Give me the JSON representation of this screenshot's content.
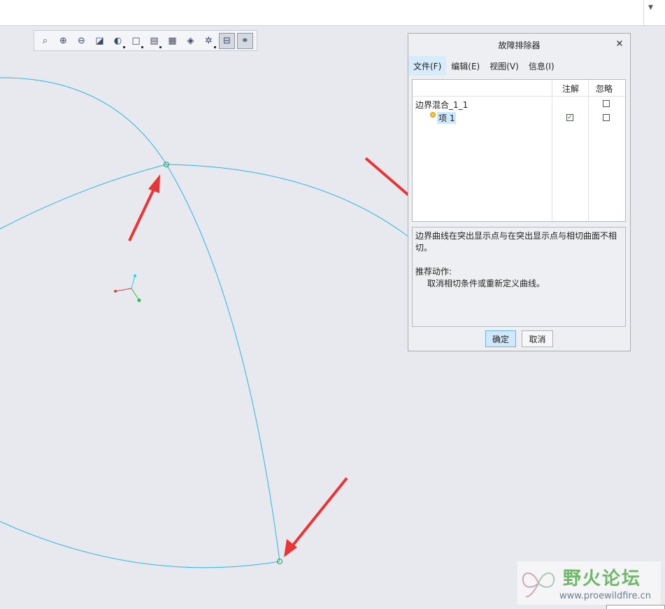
{
  "dialog": {
    "title": "故障排除器",
    "close_label": "×",
    "menu": [
      {
        "label": "文件(F)"
      },
      {
        "label": "编辑(E)"
      },
      {
        "label": "视图(V)"
      },
      {
        "label": "信息(I)"
      }
    ],
    "columns": {
      "annotation": "注解",
      "ignore": "忽略"
    },
    "tree": [
      {
        "label": "边界混合_1_1",
        "annotated": false,
        "ignored": false
      },
      {
        "label": "项 1",
        "annotated": true,
        "ignored": false,
        "selected": true
      }
    ],
    "message": {
      "description": "边界曲线在突出显示点与在突出显示点与相切曲面不相切。",
      "action_title": "推荐动作:",
      "action_text": "取消相切条件或重新定义曲线。"
    },
    "ok_label": "确定",
    "cancel_label": "取消"
  },
  "toolbar": {
    "buttons": [
      {
        "name": "refit-icon",
        "glyph": "⌕"
      },
      {
        "name": "zoom-in-icon",
        "glyph": "⊕"
      },
      {
        "name": "zoom-out-icon",
        "glyph": "⊖"
      },
      {
        "name": "repaint-icon",
        "glyph": "◪"
      },
      {
        "name": "display-style-icon",
        "glyph": "◐"
      },
      {
        "name": "saved-orientation-icon",
        "glyph": "□"
      },
      {
        "name": "view-manager-icon",
        "glyph": "▤"
      },
      {
        "name": "perspective-icon",
        "glyph": "▦"
      },
      {
        "name": "section-icon",
        "glyph": "◈"
      },
      {
        "name": "datum-display-icon",
        "glyph": "✲"
      },
      {
        "name": "highlight-toggle-icon",
        "glyph": "⊟"
      },
      {
        "name": "connect-points-icon",
        "glyph": "⚭"
      }
    ]
  },
  "watermark": {
    "name": "野火论坛",
    "url": "www.proewildfire.cn"
  },
  "colors": {
    "curve": "#29b6e6",
    "arrow": "#e83535",
    "background": "#e8e9ee"
  }
}
